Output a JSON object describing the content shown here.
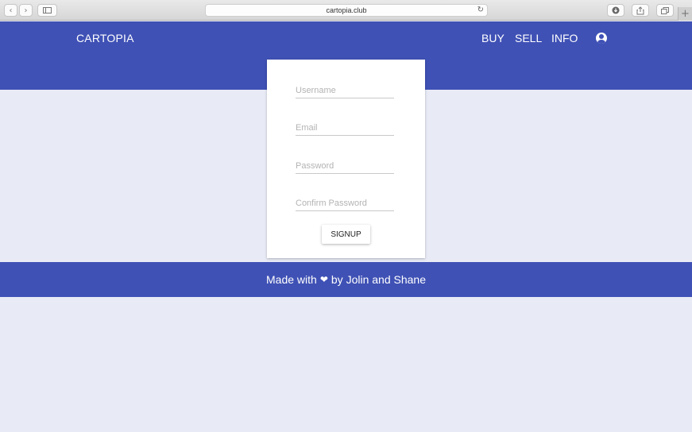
{
  "browser": {
    "url": "cartopia.club",
    "icons": {
      "back": "chevron-left-icon",
      "forward": "chevron-right-icon",
      "sidebar": "sidebar-icon",
      "reload": "reload-icon",
      "download": "download-icon",
      "share": "share-icon",
      "tabs": "tabs-icon",
      "new_tab": "plus-icon"
    }
  },
  "header": {
    "brand": "CARTOPIA",
    "nav": [
      "BUY",
      "SELL",
      "INFO"
    ],
    "account_icon": "account-circle-icon"
  },
  "form": {
    "username_placeholder": "Username",
    "email_placeholder": "Email",
    "password_placeholder": "Password",
    "confirm_placeholder": "Confirm Password",
    "submit_label": "SIGNUP"
  },
  "footer": {
    "prefix": "Made with",
    "heart": "❤",
    "suffix": "by Jolin and Shane"
  },
  "colors": {
    "primary": "#3f51b5",
    "background": "#e8eaf6",
    "card": "#ffffff"
  }
}
